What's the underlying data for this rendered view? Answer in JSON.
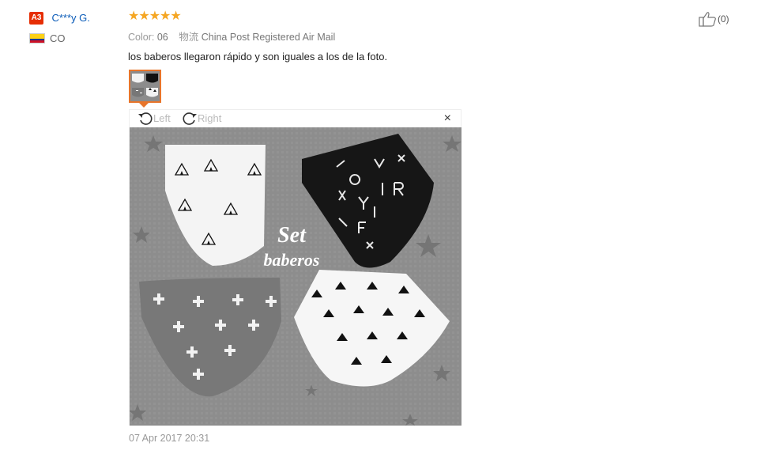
{
  "buyer": {
    "level": "A3",
    "name": "C***y G.",
    "country": "CO"
  },
  "review": {
    "rating": 5,
    "stars": "★★★★★",
    "color_label": "Color:",
    "color_value": "06",
    "shipping_label": "物流",
    "shipping_value": "China Post Registered Air Mail",
    "text": "los baberos llegaron rápido y son iguales a los de la foto.",
    "date": "07 Apr 2017 20:31"
  },
  "viewer": {
    "rotate_left_label": "Left",
    "rotate_right_label": "Right",
    "close_symbol": "×",
    "photo_caption_line1": "Set",
    "photo_caption_line2": "baberos"
  },
  "like": {
    "count_text": "(0)"
  },
  "colors": {
    "star": "#f5a623",
    "badge": "#e62e04",
    "link": "#0a5bb8",
    "thumb_border": "#e8752b"
  }
}
